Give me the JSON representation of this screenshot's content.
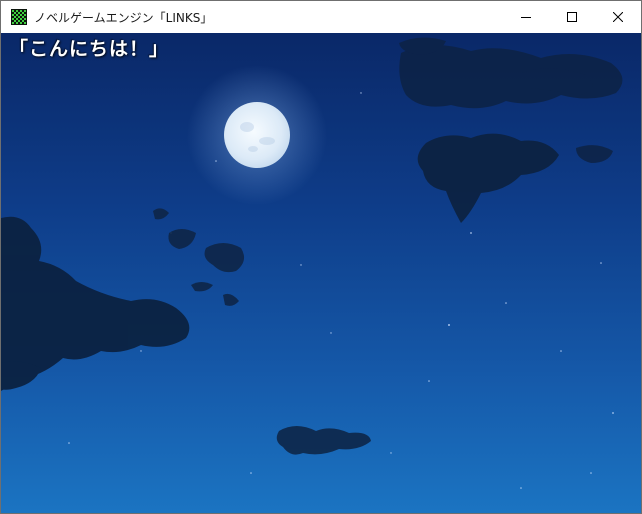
{
  "window": {
    "title": "ノベルゲームエンジン「LINKS」",
    "icon": "app-grid-icon"
  },
  "controls": {
    "minimize_icon": "minimize-icon",
    "maximize_icon": "maximize-icon",
    "close_icon": "close-icon"
  },
  "scene": {
    "background": "night-sky-with-full-moon",
    "message": "「こんにちは！」"
  },
  "colors": {
    "sky_top": "#0a2868",
    "sky_bottom": "#1a71bf",
    "moon": "#e8f2fb",
    "cloud": "#0c2240",
    "text": "#ffffff"
  }
}
